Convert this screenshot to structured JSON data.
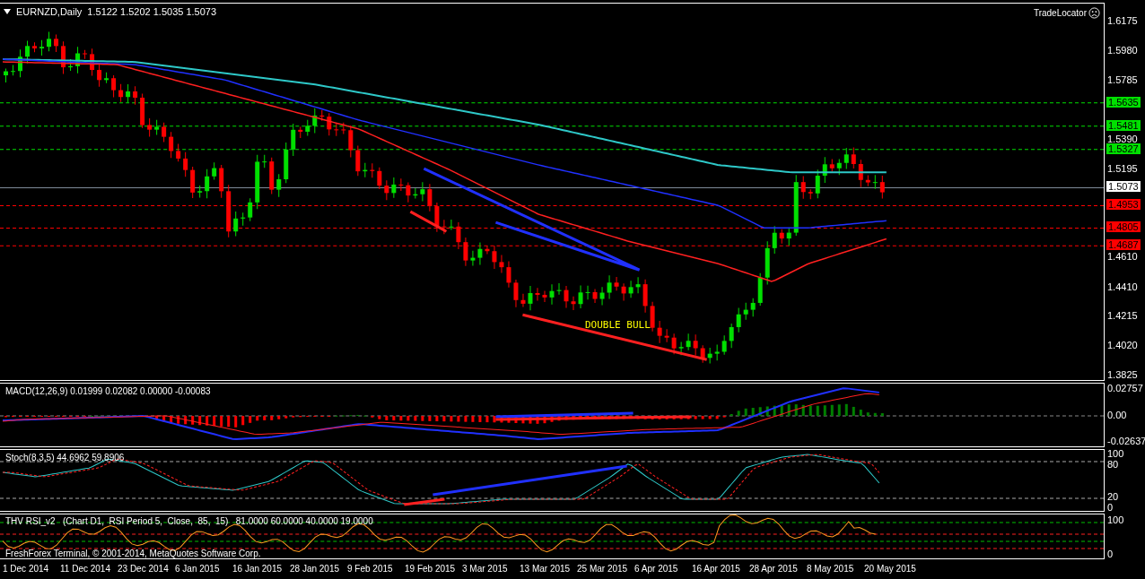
{
  "chart": {
    "symbol": "EURNZD,Daily",
    "ohlc": "1.5122 1.5202 1.5035 1.5073",
    "indicator_label": "TradeLocator",
    "annotation": "DOUBLE BULL",
    "price_ticks": [
      "1.6175",
      "1.5980",
      "1.5785",
      "1.5390",
      "1.5195",
      "1.4610",
      "1.4410",
      "1.4215",
      "1.4020",
      "1.3825"
    ],
    "price_tags": [
      {
        "value": "1.5635",
        "kind": "level",
        "color": "#00e000"
      },
      {
        "value": "1.5481",
        "kind": "level",
        "color": "#00e000"
      },
      {
        "value": "1.5327",
        "kind": "level",
        "color": "#00e000"
      },
      {
        "value": "1.5073",
        "kind": "price",
        "color": "#ffffff"
      },
      {
        "value": "1.4953",
        "kind": "level",
        "color": "#ff0000"
      },
      {
        "value": "1.4805",
        "kind": "level",
        "color": "#ff0000"
      },
      {
        "value": "1.4687",
        "kind": "level",
        "color": "#ff0000"
      }
    ]
  },
  "macd": {
    "title": "MACD(12,26,9) 0.01999 0.02082 0.00000 -0.00083",
    "ticks": [
      "0.02757",
      "0.00",
      "-0.02637"
    ]
  },
  "stoch": {
    "title": "Stoch(8,3,5) 44.6962 59.8906",
    "ticks": [
      "100",
      "80",
      "20",
      "0"
    ]
  },
  "rsi": {
    "title": "THV RSI_v2   (Chart D1,  RSI Period 5,  Close,  85,  15)   81.0000 60.0000 40.0000 19.0000",
    "ticks": [
      "100",
      "0"
    ]
  },
  "footer": "FreshForex Terminal, © 2001-2014, MetaQuotes Software Corp.",
  "dates": [
    "1 Dec 2014",
    "11 Dec 2014",
    "23 Dec 2014",
    "6 Jan 2015",
    "16 Jan 2015",
    "28 Jan 2015",
    "9 Feb 2015",
    "19 Feb 2015",
    "3 Mar 2015",
    "13 Mar 2015",
    "25 Mar 2015",
    "6 Apr 2015",
    "16 Apr 2015",
    "28 Apr 2015",
    "8 May 2015",
    "20 May 2015"
  ]
}
